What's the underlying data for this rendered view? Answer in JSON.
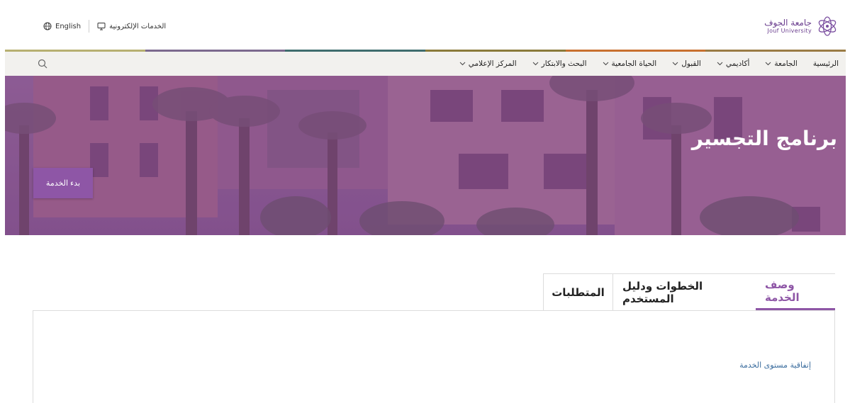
{
  "header": {
    "logo_ar": "جامعة الجوف",
    "logo_en": "Jouf University",
    "links": {
      "language": "English",
      "eservices": "الخدمات الإلكترونية"
    }
  },
  "colors": {
    "brand": "#8e56a6",
    "divider": [
      "#7a7a3a",
      "#5b3a6e",
      "#3a6a6a",
      "#6a5a2a",
      "#c86a2a",
      "#8a6a3a"
    ]
  },
  "nav": {
    "items": [
      {
        "label": "الرئيسية",
        "dropdown": false
      },
      {
        "label": "الجامعة",
        "dropdown": true
      },
      {
        "label": "أكاديمي",
        "dropdown": true
      },
      {
        "label": "القبول",
        "dropdown": true
      },
      {
        "label": "الحياة الجامعية",
        "dropdown": true
      },
      {
        "label": "البحث والابتكار",
        "dropdown": true
      },
      {
        "label": "المركز الإعلامي",
        "dropdown": true
      }
    ],
    "search_icon": "search-icon"
  },
  "hero": {
    "title": "برنامج التجسير",
    "start_button": "بدء الخدمة"
  },
  "tabs": [
    {
      "label": "وصف الخدمة",
      "active": true
    },
    {
      "label": "الخطوات ودليل المستخدم",
      "active": false
    },
    {
      "label": "المتطلبات",
      "active": false
    }
  ],
  "content": {
    "sla_link": "إتفاقية مستوى الخدمة"
  }
}
